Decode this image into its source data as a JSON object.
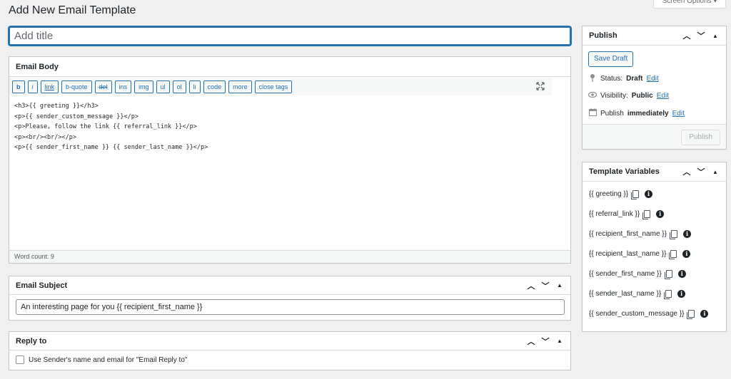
{
  "screen_options": "Screen Options ▾",
  "page_title": "Add New Email Template",
  "title_placeholder": "Add title",
  "email_body": {
    "heading": "Email Body",
    "toolbar": [
      "b",
      "i",
      "link",
      "b-quote",
      "del",
      "ins",
      "img",
      "ul",
      "ol",
      "li",
      "code",
      "more",
      "close tags"
    ],
    "content": "<h3>{{ greeting }}</h3>\n<p>{{ sender_custom_message }}</p>\n<p>Please, follow the link {{ referral_link }}</p>\n<p><br/><br/></p>\n<p>{{ sender_first_name }} {{ sender_last_name }}</p>",
    "word_count": "Word count: 9"
  },
  "email_subject": {
    "heading": "Email Subject",
    "value": "An interesting page for you {{ recipient_first_name }}"
  },
  "reply_to": {
    "heading": "Reply to",
    "checkbox_label": "Use Sender's name and email for \"Email Reply to\""
  },
  "publish": {
    "heading": "Publish",
    "save_draft": "Save Draft",
    "status_label": "Status:",
    "status_value": "Draft",
    "visibility_label": "Visibility:",
    "visibility_value": "Public",
    "schedule_label": "Publish",
    "schedule_value": "immediately",
    "edit": "Edit",
    "publish_button": "Publish"
  },
  "template_variables": {
    "heading": "Template Variables",
    "items": [
      "{{ greeting }}",
      "{{ referral_link }}",
      "{{ recipient_first_name }}",
      "{{ recipient_last_name }}",
      "{{ sender_first_name }}",
      "{{ sender_last_name }}",
      "{{ sender_custom_message }}"
    ]
  },
  "colors": {
    "accent": "#2271b1",
    "background": "#f0f0f1",
    "text": "#1d2327"
  }
}
